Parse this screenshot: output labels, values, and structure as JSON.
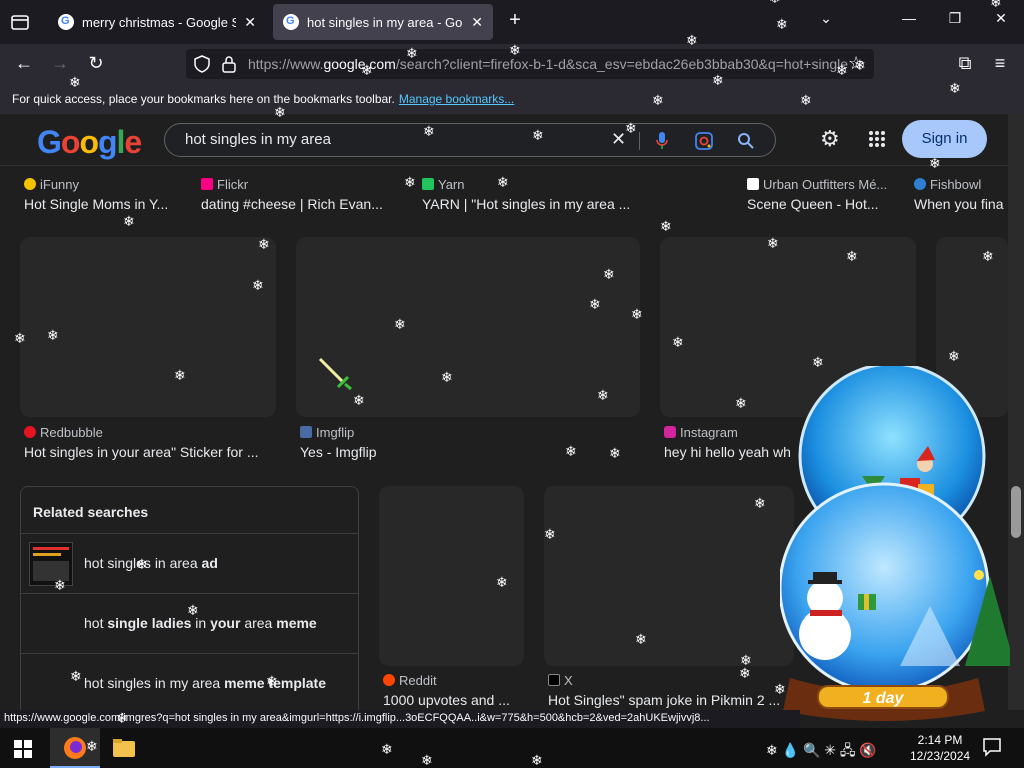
{
  "browser": {
    "tabs": [
      {
        "title": "merry christmas - Google Search",
        "active": false
      },
      {
        "title": "hot singles in my area - Google Search",
        "active": true
      }
    ],
    "url_host": "google.com",
    "url_prefix": "https://www.",
    "url_suffix": "/search?client=firefox-b-1-d&sca_esv=ebdac26eb3bbab30&q=hot+singles",
    "bookmarks_text": "For quick access, place your bookmarks here on the bookmarks toolbar.",
    "bookmarks_link": "Manage bookmarks..."
  },
  "google": {
    "logo": [
      "G",
      "o",
      "o",
      "g",
      "l",
      "e"
    ],
    "query": "hot singles in my area",
    "signin_label": "Sign in"
  },
  "results_row1": [
    {
      "source": "iFunny",
      "caption": "Hot Single Moms in Y..."
    },
    {
      "source": "Flickr",
      "caption": "dating #cheese | Rich Evan..."
    },
    {
      "source": "Yarn",
      "caption": "YARN | \"Hot singles in my area ..."
    },
    {
      "source": "Urban Outfitters Mé...",
      "caption": "Scene Queen - Hot..."
    },
    {
      "source": "Fishbowl",
      "caption": "When you fina"
    }
  ],
  "results_row2": [
    {
      "source": "Redbubble",
      "caption": "Hot singles in your area\" Sticker for ..."
    },
    {
      "source": "Imgflip",
      "caption": "Yes - Imgflip"
    },
    {
      "source": "Instagram",
      "caption": "hey hi hello yeah wh"
    }
  ],
  "results_row3": [
    {
      "source": "Reddit",
      "caption": "1000 upvotes and ..."
    },
    {
      "source": "X",
      "caption": "Hot Singles\" spam joke in Pikmin 2 ..."
    }
  ],
  "related": {
    "title": "Related searches",
    "items": [
      {
        "plain": "hot singles in area ",
        "bold": "ad"
      },
      {
        "plain": "hot single ladies in your area meme",
        "bold": ""
      },
      {
        "plain": "hot singles in my area meme template",
        "bold": ""
      }
    ]
  },
  "status_url": "https://www.google.com/imgres?q=hot singles in my area&imgurl=https://i.imgflip...3oECFQQAA..i&w=775&h=500&hcb=2&ved=2ahUKEwjivvj8...",
  "taskbar": {
    "time": "2:14 PM",
    "date": "12/23/2024"
  },
  "globe_label": "1 day",
  "icons": [
    "tab-overview-icon",
    "google-favicon",
    "close-icon",
    "new-tab-icon",
    "chevron-down-icon",
    "minimize-icon",
    "maximize-icon",
    "back-icon",
    "forward-icon",
    "reload-icon",
    "shield-icon",
    "lock-icon",
    "star-icon",
    "extensions-icon",
    "menu-icon",
    "clear-icon",
    "mic-icon",
    "lens-icon",
    "search-icon",
    "settings-icon",
    "apps-icon",
    "windows-icon",
    "firefox-icon",
    "folder-icon",
    "snowflake-icon"
  ]
}
